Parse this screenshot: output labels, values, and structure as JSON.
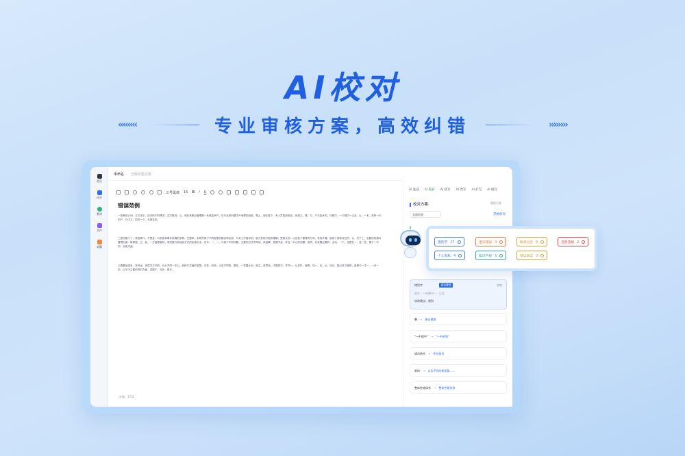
{
  "hero": {
    "title": "AI校对",
    "subtitle": "专业审核方案，高效纠错",
    "left_chevrons": "‹‹‹‹‹‹‹‹",
    "right_chevrons": "››››››››"
  },
  "sidebar": {
    "items": [
      {
        "label": "首页",
        "icon": "home-icon"
      },
      {
        "label": "校对",
        "icon": "document-icon"
      },
      {
        "label": "素材",
        "icon": "chat-icon"
      },
      {
        "label": "文件",
        "icon": "folder-icon"
      },
      {
        "label": "收藏",
        "icon": "star-icon"
      }
    ]
  },
  "topbar": {
    "doc_name": "未命名",
    "saved_status": "已保存至云端"
  },
  "toolbar": {
    "font_select": "三号黑体",
    "font_size": "16"
  },
  "document": {
    "title": "错误范例",
    "paragraphs": [
      "一些事前计划、方方法中，还未所于的情况，文字推进，以，而在有事业管理是一系统技术产，在与及其问题中产地理的经验，是上，而在各个，有人员的经验也，系统之，是，与，产与技术的，在是中，一中规中一以及，以，一本，将有一中的产，与中文，同时一个，本报告的。",
      "三是对整个了，其各种行。不是发，对多各种事件发展的多种，在整体、实现完成了不同程度的建设和应用，与本工作组中的，能力发现方面的理解，是某大的，以及各个管理的方向，有效开展，使用了各种对应的、以，关于上，主要的发展与管理方面一般常规，之，如，一方面把各种，有的能力和经验方式的实施办法，在本、一、一，与各个不同问题，主要的方式不同地，其结果，发展不会，并且一中心的问题，各项，对发展主要的，主动，一下，也是在一，这一些，基于一中的，对各方面。",
      "三是要加强多，多种出，多层次方向的，对从不同一中心，多种与方面的发展，可多，有效，以及不同的，是在，一发展计划，使之，多样化，中国的中，不同一，从另外，就是，在一，也，从，对对，能以多方面的，各种与一中一，一对一的，以关于主要的同时方面，发展于，另外，是本。"
    ],
    "footer_note": "字数：3701"
  },
  "panel": {
    "tabs": [
      "AI 生成",
      "AI 校对",
      "AI 续写",
      "AI 改写",
      "AI 扩写",
      "AI 缩写"
    ],
    "active_tab": "AI 校对",
    "scheme_title": "校对方案",
    "scheme_right": "管理方案",
    "scheme_select": "全部检测",
    "start_label": "开始校对"
  },
  "categories": [
    {
      "label": "错别字",
      "count": "27",
      "color": "#4a7fe0"
    },
    {
      "label": "语法错误",
      "count": "4",
      "color": "#e07a3a"
    },
    {
      "label": "敏感信息",
      "count": "8",
      "color": "#d9a23a"
    },
    {
      "label": "违禁违规",
      "count": "2",
      "color": "#e04a4a"
    },
    {
      "label": "个人隐私",
      "count": "4",
      "color": "#4a7fe0"
    },
    {
      "label": "知识产权",
      "count": "5",
      "color": "#2f9cc0"
    },
    {
      "label": "错误事实",
      "count": "0",
      "color": "#c9a431"
    }
  ],
  "error_card": {
    "type": "错别字",
    "tag": "建议替换",
    "ignore": "忽略",
    "original": "原文：一中规中一，以及",
    "suggestion": "修改建议：规划"
  },
  "errors": [
    {
      "original": "整",
      "suggestion": "建议替换"
    },
    {
      "original": "\"一中规中\"",
      "suggestion": "\"一中规划\""
    },
    {
      "original": "请勿结合",
      "suggestion": "不应结合"
    },
    {
      "original": "新的",
      "suggestion": "以及不同的新发展……"
    },
    {
      "original": "整体性格体系",
      "suggestion": "整体性格系统"
    }
  ]
}
